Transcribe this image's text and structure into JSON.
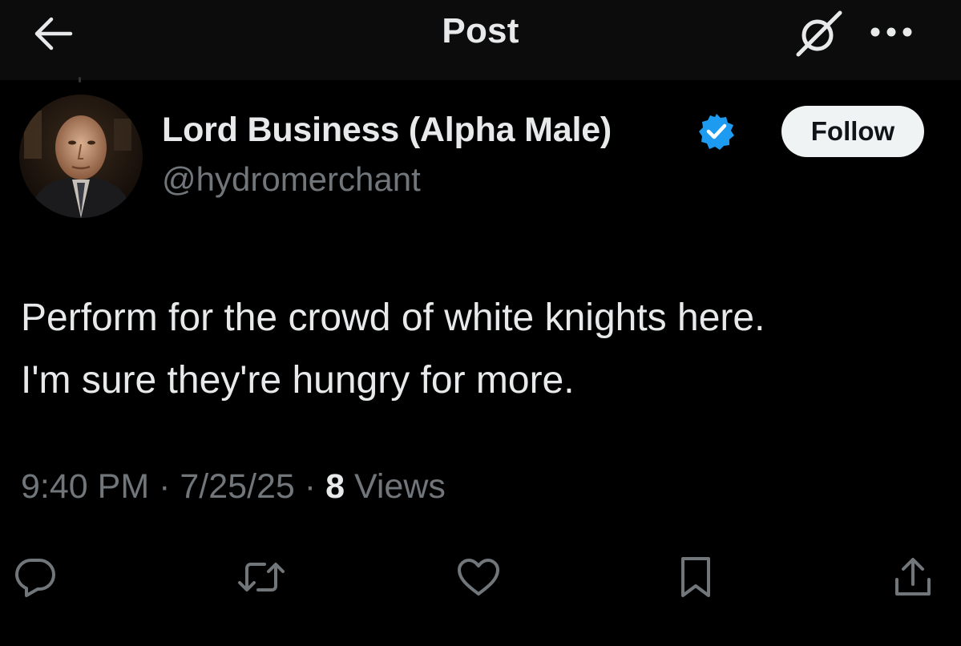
{
  "header": {
    "title": "Post",
    "back_icon": "arrow-left-icon",
    "grok_icon": "grok-icon",
    "more_icon": "more-dots-icon"
  },
  "author": {
    "display_name": "Lord Business (Alpha Male)",
    "handle": "@hydromerchant",
    "verified_icon": "verified-badge-icon",
    "verified_color": "#1d9bf0"
  },
  "follow_button": {
    "label": "Follow"
  },
  "post": {
    "line1": "Perform for the crowd of white knights here.",
    "line2": "I'm sure they're hungry for more."
  },
  "meta": {
    "time": "9:40 PM",
    "separator": "·",
    "date": "7/25/25",
    "views_count": "8",
    "views_label": "Views"
  },
  "actions": [
    {
      "name": "reply",
      "icon": "reply-icon"
    },
    {
      "name": "repost",
      "icon": "repost-icon"
    },
    {
      "name": "like",
      "icon": "heart-icon"
    },
    {
      "name": "bookmark",
      "icon": "bookmark-icon"
    },
    {
      "name": "share",
      "icon": "share-icon"
    }
  ],
  "colors": {
    "background": "#000000",
    "header_bg": "#0c0c0c",
    "text_primary": "#e7e9ea",
    "text_secondary": "#71767b",
    "accent": "#1d9bf0"
  }
}
